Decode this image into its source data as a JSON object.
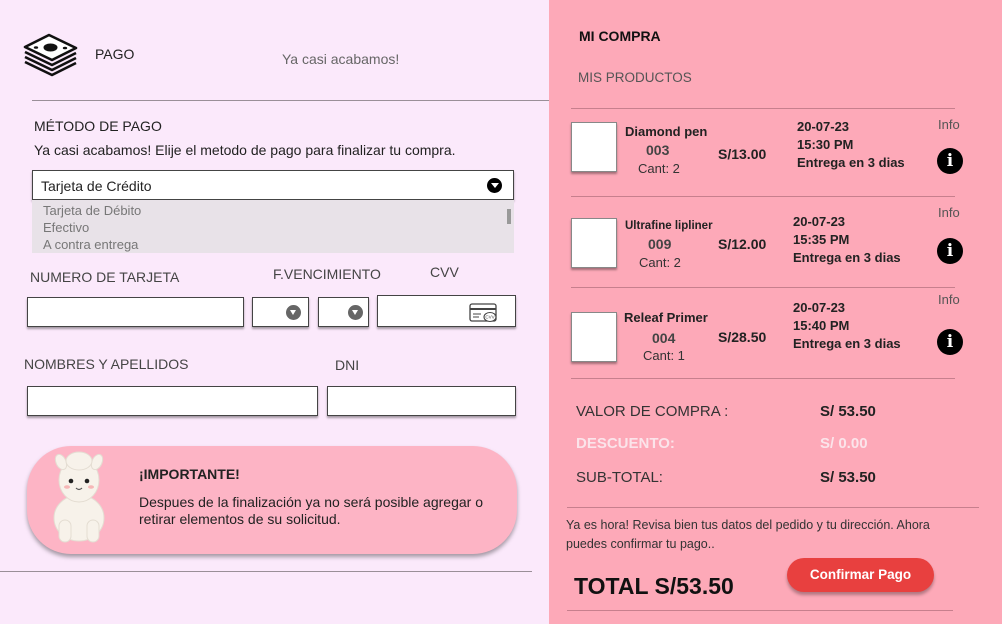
{
  "colors": {
    "left_bg": "#fbe9fb",
    "right_bg": "#fda9b8",
    "notice_bg": "#fdb4c5",
    "button_bg": "#e8403f",
    "discount_text": "#fbe4ea"
  },
  "header": {
    "title": "PAGO",
    "subtitle": "Ya casi acabamos!",
    "icon": "money-stack-icon"
  },
  "payment": {
    "section_title": "MÉTODO DE PAGO",
    "instructions": "Ya casi acabamos! Elije el metodo de pago para finalizar tu compra.",
    "selected_method": "Tarjeta de Crédito",
    "options": [
      "Tarjeta de Débito",
      "Efectivo",
      "A contra entrega"
    ]
  },
  "form": {
    "card_number_label": "NUMERO DE TARJETA",
    "expiry_label": "F.VENCIMIENTO",
    "cvv_label": "CVV",
    "name_label": "NOMBRES Y APELLIDOS",
    "dni_label": "DNI"
  },
  "notice": {
    "title": "¡IMPORTANTE!",
    "text_line1": "Despues de la finalización ya no será posible agregar o",
    "text_line2": "retirar elementos de su solicitud."
  },
  "summary": {
    "title": "MI COMPRA",
    "subtitle": "MIS PRODUCTOS",
    "info_label": "Info",
    "products": [
      {
        "name": "Diamond pen",
        "code": "003",
        "qty": "Cant: 2",
        "price": "S/13.00",
        "date": "20-07-23",
        "time": "15:30 PM",
        "delivery": "Entrega en 3 dias"
      },
      {
        "name": "Ultrafine lipliner",
        "code": "009",
        "qty": "Cant: 2",
        "price": "S/12.00",
        "date": "20-07-23",
        "time": "15:35 PM",
        "delivery": "Entrega en 3 dias"
      },
      {
        "name": "Releaf Primer",
        "code": "004",
        "qty": "Cant: 1",
        "price": "S/28.50",
        "date": "20-07-23",
        "time": "15:40 PM",
        "delivery": "Entrega en 3 dias"
      }
    ],
    "valor_label": "VALOR DE COMPRA :",
    "valor_value": "S/ 53.50",
    "descuento_label": "DESCUENTO:",
    "descuento_value": "S/ 0.00",
    "subtotal_label": "SUB-TOTAL:",
    "subtotal_value": "S/ 53.50",
    "message_line1": "Ya es hora! Revisa bien tus datos del pedido y tu dirección. Ahora",
    "message_line2": "puedes confirmar tu pago..",
    "total": "TOTAL S/53.50",
    "confirm_button": "Confirmar Pago"
  }
}
